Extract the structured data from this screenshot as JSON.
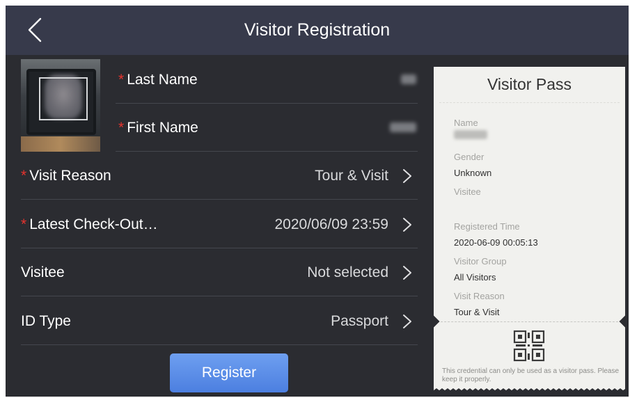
{
  "header": {
    "title": "Visitor Registration"
  },
  "form": {
    "last_name_label": "Last Name",
    "first_name_label": "First Name",
    "visit_reason_label": "Visit Reason",
    "visit_reason_value": "Tour & Visit",
    "checkout_label": "Latest Check-Out…",
    "checkout_value": "2020/06/09 23:59",
    "visitee_label": "Visitee",
    "visitee_value": "Not selected",
    "id_type_label": "ID Type",
    "id_type_value": "Passport",
    "required_mark": "*",
    "register_label": "Register"
  },
  "pass": {
    "title": "Visitor Pass",
    "name_label": "Name",
    "gender_label": "Gender",
    "gender_value": "Unknown",
    "visitee_label": "Visitee",
    "registered_time_label": "Registered Time",
    "registered_time_value": "2020-06-09  00:05:13",
    "visitor_group_label": "Visitor Group",
    "visitor_group_value": "All Visitors",
    "visit_reason_label": "Visit Reason",
    "visit_reason_value": "Tour & Visit",
    "note": "This credential can only be used as a visitor pass. Please keep it properly."
  },
  "colors": {
    "header_bg": "#373a4b",
    "screen_bg": "#2b2c31",
    "required": "#e7332e",
    "button_accent": "#5a8ae6",
    "pass_bg": "#f1f1ee"
  },
  "icons": {
    "back": "back-chevron-icon",
    "row_arrow": "chevron-right-icon",
    "qr": "qr-code-icon"
  }
}
